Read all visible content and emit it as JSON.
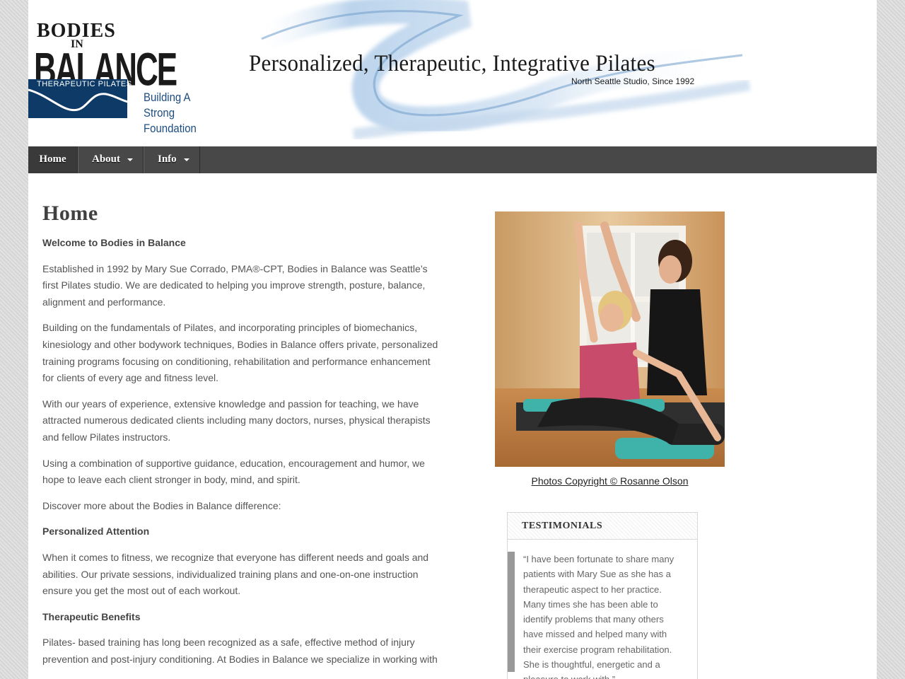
{
  "header": {
    "logo": {
      "line1": "BODIES",
      "line2": "IN",
      "line3": "BALANCE",
      "box_label": "THERAPEUTIC PILATES",
      "tagline_1": "Building A",
      "tagline_2": "Strong Foundation"
    },
    "banner_title": "Personalized, Therapeutic, Integrative Pilates",
    "banner_subtitle": "North Seattle Studio, Since 1992"
  },
  "nav": {
    "items": [
      {
        "label": "Home",
        "has_dropdown": false
      },
      {
        "label": "About",
        "has_dropdown": true
      },
      {
        "label": "Info",
        "has_dropdown": true
      }
    ]
  },
  "main": {
    "title": "Home",
    "paragraphs": [
      "Welcome to Bodies in Balance",
      "Established in 1992 by Mary Sue Corrado, PMA®-CPT, Bodies in Balance was Seattle’s first Pilates studio. We are dedicated to helping you improve strength, posture, balance, alignment and performance.",
      "Building on the fundamentals of Pilates, and incorporating principles of biomechanics, kinesiology and other bodywork techniques, Bodies in Balance offers private, personalized training programs focusing on conditioning, rehabilitation and performance enhancement for clients of every age and fitness level.",
      "With our years of experience, extensive knowledge and passion for teaching, we have attracted numerous dedicated clients including many doctors, nurses, physical therapists and fellow Pilates instructors.",
      "Using a combination of supportive guidance, education, encouragement and humor, we hope to leave each client stronger in body, mind, and spirit.",
      "Discover more about the Bodies in Balance difference:",
      "Personalized Attention",
      "When it comes to fitness, we recognize that everyone has different needs and goals and abilities. Our private sessions, individualized training plans and one-on-one instruction ensure you get the most out of each workout.",
      "Therapeutic Benefits",
      "Pilates- based training has long been recognized as a safe, effective method of injury prevention and post-injury conditioning. At Bodies in Balance we specialize in working with"
    ]
  },
  "sidebar": {
    "photo_caption": "Photos Copyright © Rosanne Olson",
    "testimonials": {
      "heading": "TESTIMONIALS",
      "quote": "“I have been fortunate to share many patients with Mary Sue as she has a therapeutic aspect to her practice. Many times she has been able to identify problems that many others have missed and helped many with their exercise program rehabilitation. She is thoughtful, energetic and a pleasure to work with.”"
    }
  },
  "colors": {
    "nav_bg": "#484848",
    "logo_blue": "#0d3a66",
    "text": "#555555",
    "swirl_blue": "#8fb3d9"
  }
}
